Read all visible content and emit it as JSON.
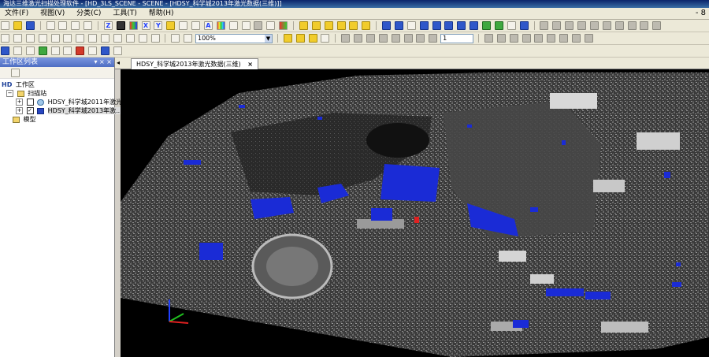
{
  "title_bar": {
    "text": "海达三维激光扫描处理软件 - [HD_3LS_SCENE - SCENE - [HDSY_科学城2013年激光数据(三维)]]"
  },
  "menubar": {
    "items": [
      "文件(F)",
      "视图(V)",
      "分类(C)",
      "工具(T)",
      "帮助(H)"
    ],
    "controls": "- 8"
  },
  "toolbar": {
    "zoom_value": "100%",
    "frame_value": "1",
    "axis_labels": [
      "Z",
      "X",
      "Y",
      "A"
    ]
  },
  "panel": {
    "title": "工作区列表",
    "controls": "▾ × ×",
    "tree": {
      "root": "工作区",
      "stations": "扫描站",
      "station_items": [
        "HDSY_科学城2011年激光...",
        "HDSY_科学城2013年激..."
      ],
      "models": "模型"
    }
  },
  "tabs": {
    "nav": "◂",
    "active_label": "HDSY_科学城2013年激光数据(三维)",
    "close": "×"
  },
  "colors": {
    "point_cloud_highlight": "#1a2bd6",
    "point_cloud_gray": "#8a8a8a",
    "background": "#000000",
    "axis_x": "#e02020",
    "axis_y": "#20c020",
    "axis_z": "#2040ff"
  }
}
